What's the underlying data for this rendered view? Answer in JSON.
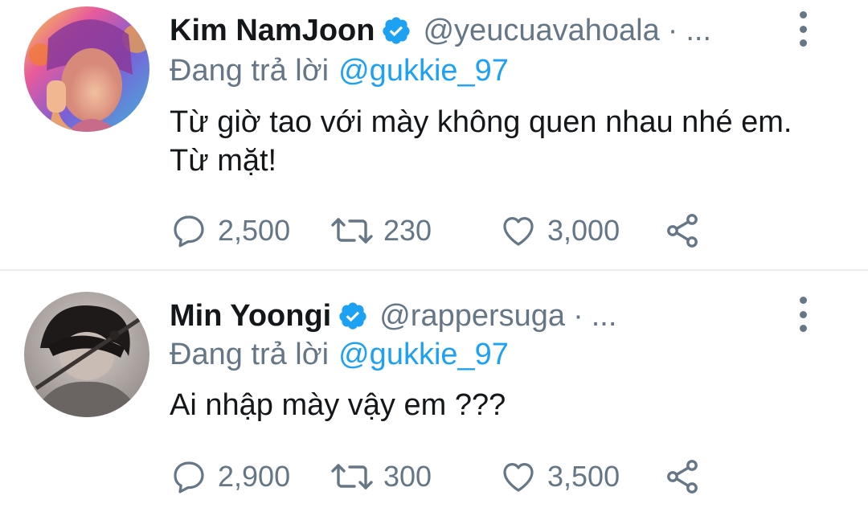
{
  "tweets": [
    {
      "display_name": "Kim NamJoon",
      "handle": "@yeucuavahoala",
      "separator": "·",
      "truncation": "...",
      "reply_prefix": "Đang trả lời",
      "reply_to": "@gukkie_97",
      "text": "Từ giờ tao với mày không quen nhau nhé em. Từ mặt!",
      "replies": "2,500",
      "retweets": "230",
      "likes": "3,000",
      "verified": true
    },
    {
      "display_name": "Min Yoongi",
      "handle": "@rappersuga",
      "separator": "·",
      "truncation": "...",
      "reply_prefix": "Đang trả lời",
      "reply_to": "@gukkie_97",
      "text": "Ai nhập mày vậy em ???",
      "replies": "2,900",
      "retweets": "300",
      "likes": "3,500",
      "verified": true
    }
  ],
  "icons": [
    "verified-badge-icon",
    "more-vertical-icon",
    "reply-icon",
    "retweet-icon",
    "like-icon",
    "share-icon"
  ],
  "colors": {
    "accent": "#1da1f2",
    "text_primary": "#14171a",
    "text_secondary": "#657786",
    "divider": "#e6ecf0"
  }
}
